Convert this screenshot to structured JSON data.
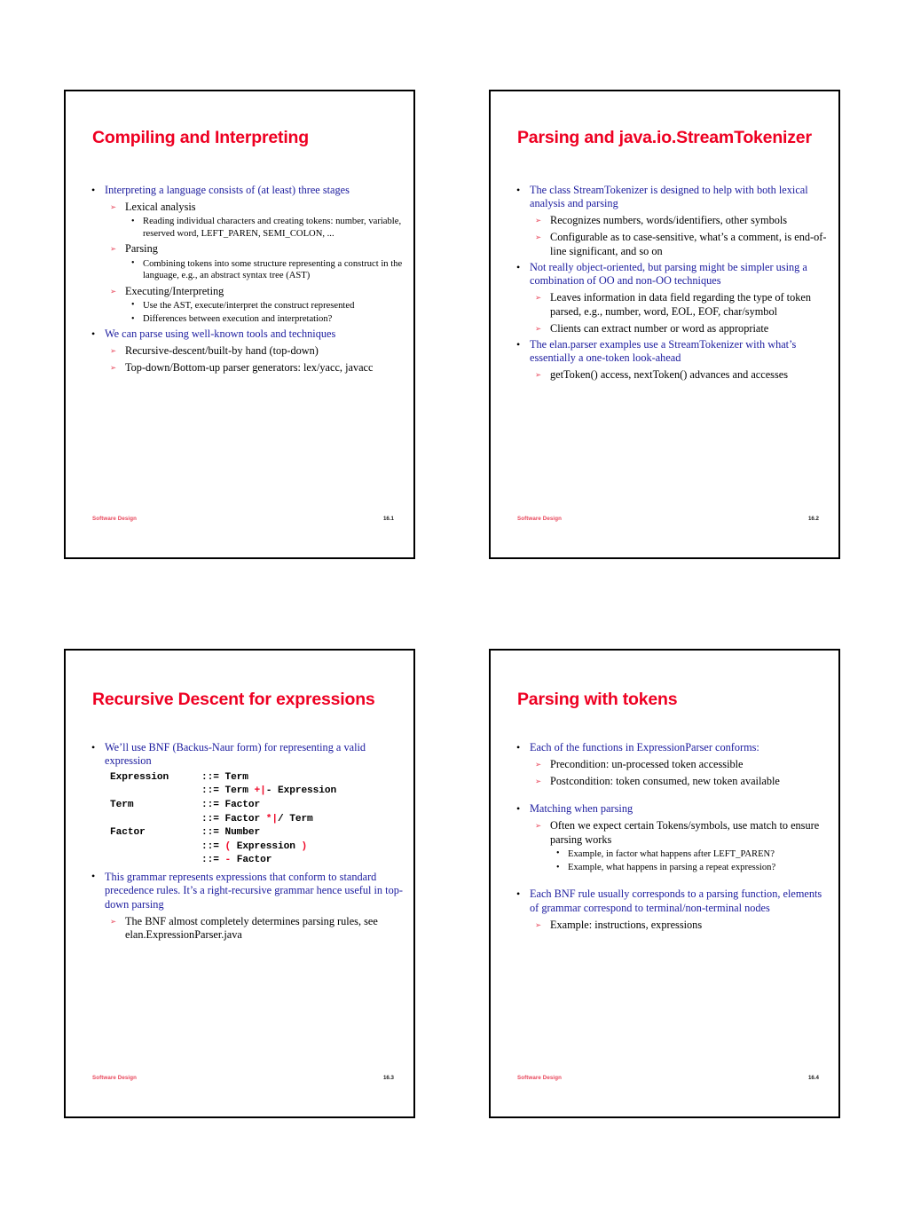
{
  "colors": {
    "title_red": "#ee0022",
    "body_blue": "#1b1b9e",
    "arrow_red": "#e8455a",
    "code_red": "#ef0a2a",
    "text_black": "#000000",
    "frame_black": "#000000",
    "page_background": "#ffffff"
  },
  "footer": {
    "label": "Software Design"
  },
  "slides": [
    {
      "title": "Compiling and Interpreting",
      "page_number": "16.1",
      "bullets": [
        {
          "level": 1,
          "text": "Interpreting a language consists of (at least) three stages"
        },
        {
          "level": 2,
          "text": "Lexical analysis"
        },
        {
          "level": 3,
          "text": "Reading individual characters and creating tokens: number, variable, reserved word, LEFT_PAREN, SEMI_COLON, ..."
        },
        {
          "level": 2,
          "text": "Parsing"
        },
        {
          "level": 3,
          "text": "Combining tokens into some structure representing a construct in the language, e.g., an abstract syntax tree (AST)"
        },
        {
          "level": 2,
          "text": "Executing/Interpreting"
        },
        {
          "level": 3,
          "text": "Use the AST, execute/interpret the construct represented"
        },
        {
          "level": 3,
          "text": "Differences between execution and interpretation?"
        },
        {
          "level": 1,
          "text": "We can parse using well-known tools and techniques"
        },
        {
          "level": 2,
          "text": "Recursive-descent/built-by hand (top-down)"
        },
        {
          "level": 2,
          "text": "Top-down/Bottom-up parser generators: lex/yacc, javacc"
        }
      ]
    },
    {
      "title": "Parsing and java.io.StreamTokenizer",
      "page_number": "16.2",
      "bullets": [
        {
          "level": 1,
          "text": "The class StreamTokenizer is designed to help with both lexical analysis and parsing"
        },
        {
          "level": 2,
          "text": "Recognizes numbers, words/identifiers, other symbols"
        },
        {
          "level": 2,
          "text": "Configurable as to case-sensitive, what’s a comment, is end-of-line significant, and so on"
        },
        {
          "level": 1,
          "text": "Not really object-oriented, but parsing might be simpler using a combination of OO and non-OO techniques"
        },
        {
          "level": 2,
          "text": "Leaves information in data field regarding the type of token parsed, e.g., number, word, EOL, EOF, char/symbol"
        },
        {
          "level": 2,
          "text": "Clients can extract number or word as appropriate"
        },
        {
          "level": 1,
          "text": "The elan.parser examples use a StreamTokenizer with what’s essentially a one-token look-ahead"
        },
        {
          "level": 2,
          "text": "getToken() access, nextToken() advances and accesses"
        }
      ]
    },
    {
      "title": "Recursive Descent for expressions",
      "page_number": "16.3",
      "bullets_before_code": [
        {
          "level": 1,
          "text": "We’ll use BNF (Backus-Naur form) for representing a valid expression"
        }
      ],
      "code": [
        {
          "lhs": "Expression",
          "parts": [
            {
              "t": "::= Term",
              "red": false
            }
          ]
        },
        {
          "lhs": "",
          "parts": [
            {
              "t": "::= Term ",
              "red": false
            },
            {
              "t": "+|",
              "red": true
            },
            {
              "t": "- Expression",
              "red": false
            }
          ]
        },
        {
          "lhs": "Term",
          "parts": [
            {
              "t": "::= Factor",
              "red": false
            }
          ]
        },
        {
          "lhs": "",
          "parts": [
            {
              "t": "::= Factor ",
              "red": false
            },
            {
              "t": "*|",
              "red": true
            },
            {
              "t": "/ Term",
              "red": false
            }
          ]
        },
        {
          "lhs": "Factor",
          "parts": [
            {
              "t": "::= Number",
              "red": false
            }
          ]
        },
        {
          "lhs": "",
          "parts": [
            {
              "t": "::= ",
              "red": false
            },
            {
              "t": "(",
              "red": true
            },
            {
              "t": " Expression ",
              "red": false
            },
            {
              "t": ")",
              "red": true
            }
          ]
        },
        {
          "lhs": "",
          "parts": [
            {
              "t": "::= ",
              "red": false
            },
            {
              "t": "-",
              "red": true
            },
            {
              "t": " Factor",
              "red": false
            }
          ]
        }
      ],
      "bullets_after_code": [
        {
          "level": 1,
          "text": "This grammar represents expressions that conform to standard precedence rules. It’s a right-recursive grammar hence useful in top-down parsing"
        },
        {
          "level": 2,
          "text": "The BNF almost completely determines parsing rules, see elan.ExpressionParser.java"
        }
      ]
    },
    {
      "title": "Parsing with tokens",
      "page_number": "16.4",
      "bullets": [
        {
          "level": 1,
          "text": "Each of the functions in ExpressionParser conforms:"
        },
        {
          "level": 2,
          "text": "Precondition: un-processed token accessible"
        },
        {
          "level": 2,
          "text": "Postcondition: token consumed, new token available"
        },
        {
          "level": 0,
          "text": ""
        },
        {
          "level": 1,
          "text": "Matching when parsing"
        },
        {
          "level": 2,
          "text": "Often we expect certain Tokens/symbols, use match to ensure parsing works"
        },
        {
          "level": 3,
          "text": "Example, in factor what happens after LEFT_PAREN?"
        },
        {
          "level": 3,
          "text": "Example, what happens in parsing a repeat expression?"
        },
        {
          "level": 0,
          "text": ""
        },
        {
          "level": 1,
          "text": "Each BNF rule usually corresponds to a parsing function, elements of grammar correspond to terminal/non-terminal nodes"
        },
        {
          "level": 2,
          "text": "Example: instructions, expressions"
        }
      ]
    }
  ]
}
